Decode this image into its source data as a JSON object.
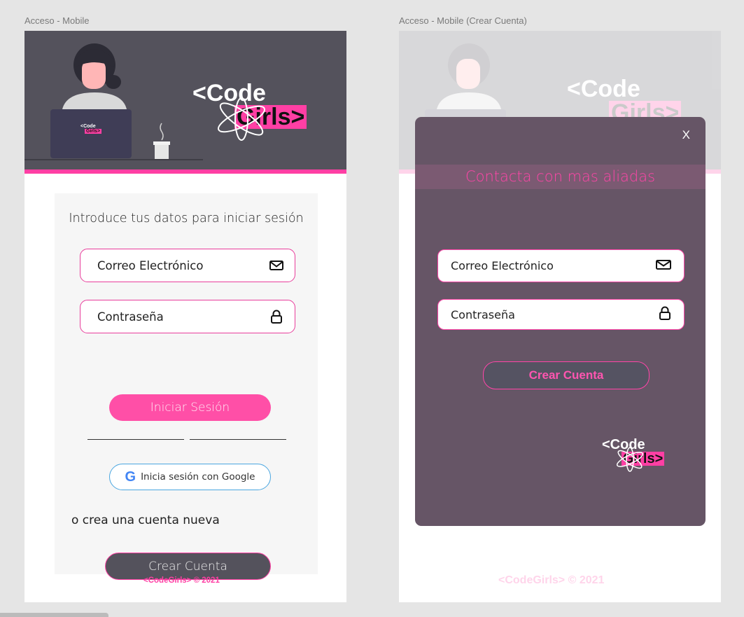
{
  "frames": {
    "left_label": "Acceso - Mobile",
    "right_label": "Acceso - Mobile (Crear Cuenta)"
  },
  "brand": {
    "logo_line1": "<Code",
    "logo_line2": "Girls>",
    "laptop_line1": "<Code",
    "laptop_line2": "Girls>",
    "pink": "#ff3fa4",
    "dark": "#54525c",
    "modal": "#665566"
  },
  "login": {
    "intro": "Introduce tus datos para iniciar sesión",
    "email_placeholder": "Correo Electrónico",
    "password_placeholder": "Contraseña",
    "email_icon": "mail-icon",
    "password_icon": "lock-icon",
    "submit_label": "Iniciar Sesión",
    "google_label": "Inicia sesión con Google",
    "google_glyph": "G",
    "alt_text": "o crea una cuenta nueva",
    "create_label": "Crear Cuenta",
    "footer": "<CodeGirls> © 2021"
  },
  "signup_modal": {
    "close": "X",
    "title": "Contacta con mas aliadas",
    "email_placeholder": "Correo Electrónico",
    "password_placeholder": "Contraseña",
    "create_label": "Crear Cuenta",
    "logo_line1": "<Code",
    "logo_line2": "Girls>",
    "footer": "<CodeGirls> © 2021"
  }
}
